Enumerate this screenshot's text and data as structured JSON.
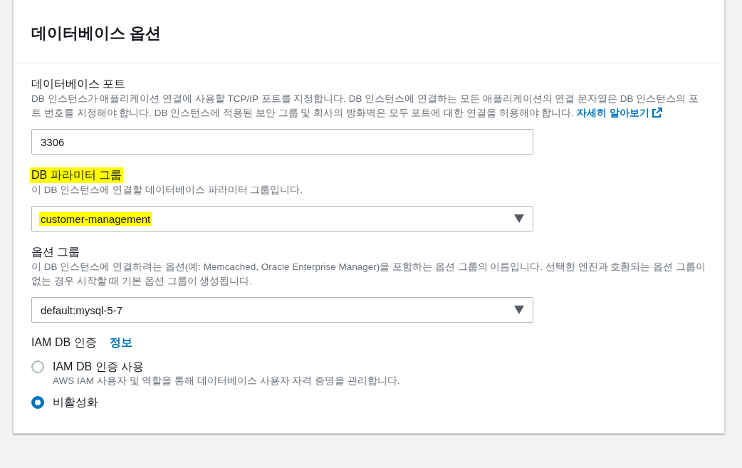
{
  "section": {
    "title": "데이터베이스 옵션"
  },
  "fields": [
    {
      "kind": "text",
      "label": "데이터베이스 포트",
      "label_highlighted": false,
      "description": "DB 인스턴스가 애플리케이션 연결에 사용할 TCP/IP 포트를 지정합니다. DB 인스턴스에 연결하는 모든 애플리케이션의 연결 문자열은 DB 인스턴스의 포트 번호를 지정해야 합니다. DB 인스턴스에 적용된 보안 그룹 및 회사의 방화벽은 모두 포트에 대한 연결을 허용해야 합니다.",
      "link": "자세히 알아보기",
      "value": "3306",
      "value_highlighted": false
    },
    {
      "kind": "select",
      "label": "DB 파라미터 그룹",
      "label_highlighted": true,
      "description": "이 DB 인스턴스에 연결할 데이터베이스 파라미터 그룹입니다.",
      "value": "customer-management",
      "value_highlighted": true
    },
    {
      "kind": "select",
      "label": "옵션 그룹",
      "label_highlighted": false,
      "description": "이 DB 인스턴스에 연결하려는 옵션(예: Memcached, Oracle Enterprise Manager)을 포함하는 옵션 그룹의 이름입니다. 선택한 엔진과 호환되는 옵션 그룹이 없는 경우 시작할 때 기본 옵션 그룹이 생성됩니다.",
      "value": "default:mysql-5-7",
      "value_highlighted": false
    }
  ],
  "iam": {
    "label": "IAM DB 인증",
    "info_link": "정보",
    "options": [
      {
        "label": "IAM DB 인증 사용",
        "description": "AWS IAM 사용자 및 역할을 통해 데이터베이스 사용자 자격 증명을 관리합니다.",
        "selected": false
      },
      {
        "label": "비활성화",
        "selected": true
      }
    ]
  }
}
